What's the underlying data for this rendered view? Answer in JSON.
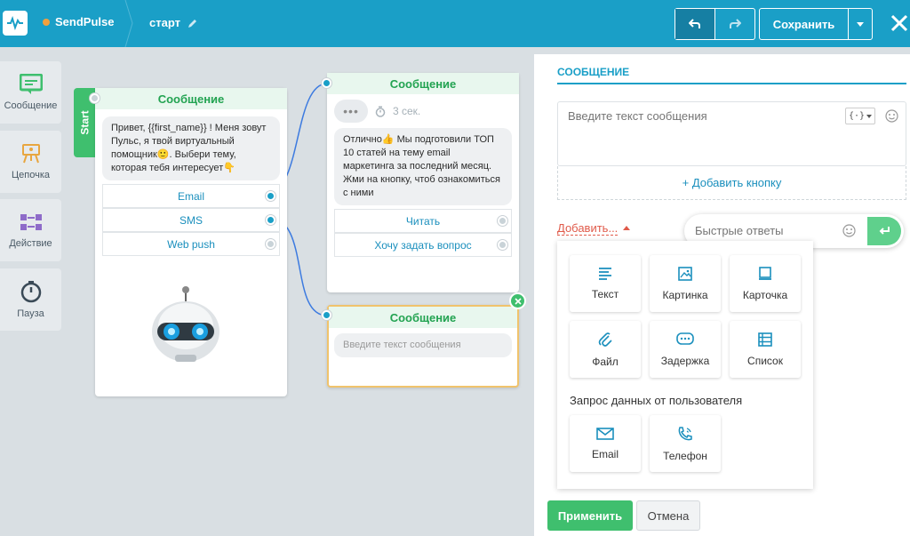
{
  "app": {
    "brand": "SendPulse",
    "flow_name": "старт"
  },
  "toolbar": {
    "save_label": "Сохранить"
  },
  "tools": [
    {
      "label": "Сообщение",
      "icon": "message-icon",
      "color": "#3fbf6e"
    },
    {
      "label": "Цепочка",
      "icon": "chain-icon",
      "color": "#e8a640"
    },
    {
      "label": "Действие",
      "icon": "action-icon",
      "color": "#8e6bc9"
    },
    {
      "label": "Пауза",
      "icon": "timer-icon",
      "color": "#3a4a57"
    }
  ],
  "nodes": {
    "start_tab": "Start",
    "first": {
      "title": "Сообщение",
      "text": "Привет, {{first_name}} ! Меня зовут Пульс, я твой виртуальный помощник🙂. Выбери тему, которая тебя интересует👇",
      "buttons": [
        "Email",
        "SMS",
        "Web push"
      ]
    },
    "second": {
      "title": "Сообщение",
      "delay": "3 сек.",
      "text": "Отлично👍 Мы подготовили ТОП 10 статей на тему email маркетинга за последний месяц. Жми на кнопку, чтоб ознакомиться с ними",
      "buttons": [
        "Читать",
        "Хочу задать вопрос"
      ]
    },
    "third": {
      "title": "Сообщение",
      "placeholder": "Введите текст сообщения"
    }
  },
  "panel": {
    "title": "СООБЩЕНИЕ",
    "message_placeholder": "Введите текст сообщения",
    "add_button_label": "+ Добавить кнопку",
    "add_link": "Добавить...",
    "quick_placeholder": "Быстрые ответы",
    "tiles": [
      {
        "label": "Текст",
        "icon": "text-icon"
      },
      {
        "label": "Картинка",
        "icon": "image-icon"
      },
      {
        "label": "Карточка",
        "icon": "card-icon"
      },
      {
        "label": "Файл",
        "icon": "attachment-icon"
      },
      {
        "label": "Задержка",
        "icon": "typing-icon"
      },
      {
        "label": "Список",
        "icon": "list-icon"
      }
    ],
    "user_request_label": "Запрос данных от пользователя",
    "request_tiles": [
      {
        "label": "Email",
        "icon": "mail-icon"
      },
      {
        "label": "Телефон",
        "icon": "phone-icon"
      }
    ],
    "apply_label": "Применить",
    "cancel_label": "Отмена"
  },
  "colors": {
    "topbar": "#1a9fc7",
    "accent_green": "#3fbf6e",
    "link_blue": "#1a8fbd",
    "add_red": "#e05a4a"
  }
}
